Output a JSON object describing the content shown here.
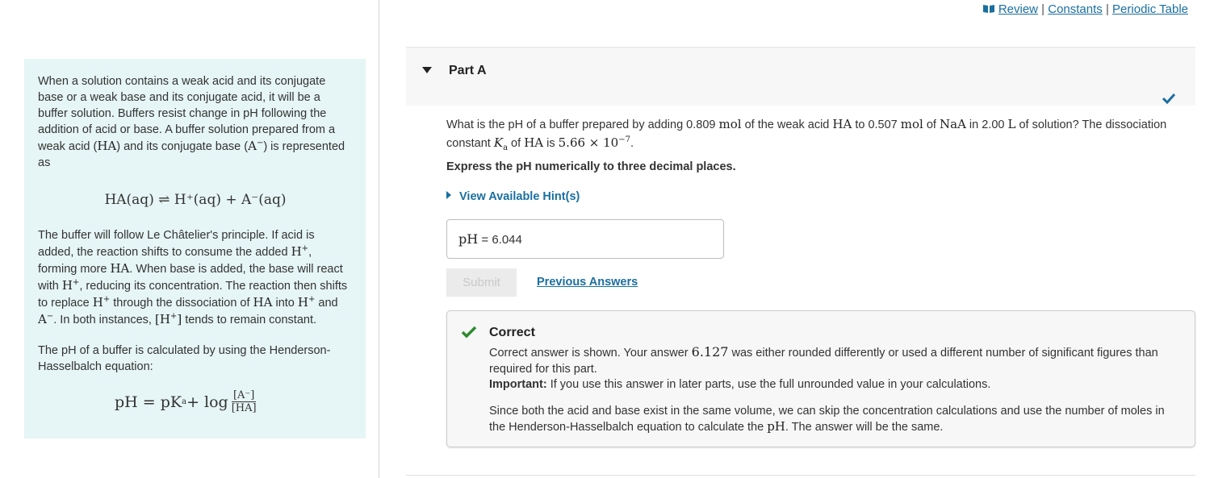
{
  "links": {
    "review": "Review",
    "constants": "Constants",
    "periodic_table": "Periodic Table",
    "separator": "|"
  },
  "intro": {
    "p1_a": "When a solution contains a weak acid and its conjugate base or a weak base and its conjugate acid, it will be a buffer  solution. Buffers resist change in pH following the addition of acid or base. A buffer solution prepared from a weak acid (",
    "p1_b": ") and its conjugate base (",
    "p1_c": ") is represented as",
    "equilibrium": "HA(aq) ⇌ H⁺(aq) + A⁻(aq)",
    "p2_a": "The buffer will follow Le Châtelier's principle. If acid is added, the reaction shifts to consume the added ",
    "p2_b": ", forming more ",
    "p2_c": ". When base is added, the base will react with ",
    "p2_d": ", reducing its concentration. The reaction then shifts to replace ",
    "p2_e": " through the dissociation of ",
    "p2_f": " into ",
    "p2_g": " and ",
    "p2_h": ". In both instances, ",
    "p2_i": " tends to remain constant.",
    "p3": "The pH of a buffer is calculated by using the Henderson-Hasselbalch equation:",
    "hh_lhs": "pH = pK",
    "hh_sub": "a",
    "hh_plus": " + log",
    "hh_num": "[A⁻]",
    "hh_den": "[HA]"
  },
  "part": {
    "title": "Part A"
  },
  "question": {
    "q_a": "What is the pH of a buffer prepared by adding 0.809 ",
    "q_mol1": "mol",
    "q_b": " of the weak acid ",
    "q_ha": "HA",
    "q_c": " to 0.507 ",
    "q_mol2": "mol",
    "q_d": " of ",
    "q_naa": "NaA",
    "q_e": " in 2.00 ",
    "q_l": "L",
    "q_f": " of solution? The dissociation constant ",
    "q_ka": "K",
    "q_ka_sub": "a",
    "q_g": " of ",
    "q_ha2": "HA",
    "q_h": " is ",
    "q_val": "5.66 × 10",
    "q_exp": "−7",
    "q_i": ".",
    "express": "Express the pH numerically to three decimal places.",
    "hints": "View Available Hint(s)"
  },
  "answer": {
    "label": "pH",
    "equals": " = ",
    "value": "6.044"
  },
  "buttons": {
    "submit": "Submit",
    "previous_answers": "Previous Answers"
  },
  "feedback": {
    "title": "Correct",
    "line1_a": "Correct answer is shown. Your answer ",
    "line1_val": "6.127",
    "line1_b": "  was either rounded differently or used a different number of significant figures than required for this part.",
    "important_label": "Important:",
    "important_text": " If you use this answer in later parts, use the full unrounded value in your calculations.",
    "extra_a": "Since both the acid and base exist in the same volume, we can skip the concentration calculations and use the number of moles in the Henderson-Hasselbalch equation to calculate the ",
    "extra_ph": "pH",
    "extra_b": ". The answer will be the same."
  },
  "colors": {
    "link": "#1a6fa0",
    "intro_bg": "#e6f5f5",
    "correct_green": "#2e8b2e"
  }
}
